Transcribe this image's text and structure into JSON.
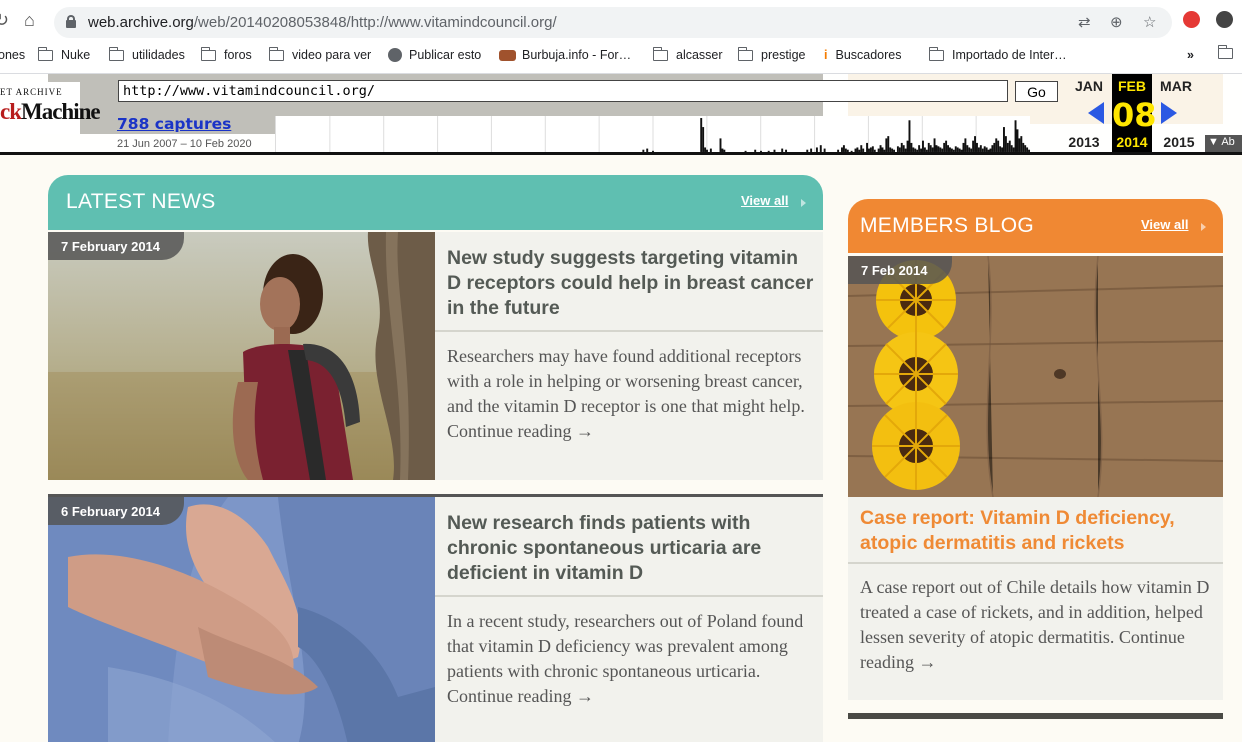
{
  "browser": {
    "url_host": "web.archive.org",
    "url_path": "/web/20140208053848/http://www.vitamindcouncil.org/"
  },
  "bookmarks": [
    {
      "label": "ones",
      "icon": "none"
    },
    {
      "label": "Nuke",
      "icon": "folder-icon"
    },
    {
      "label": "utilidades",
      "icon": "folder-icon"
    },
    {
      "label": "foros",
      "icon": "folder-icon"
    },
    {
      "label": "video para ver",
      "icon": "folder-icon"
    },
    {
      "label": "Publicar esto",
      "icon": "globe-icon"
    },
    {
      "label": "Burbuja.info - For…",
      "icon": "bread-icon"
    },
    {
      "label": "alcasser",
      "icon": "folder-icon"
    },
    {
      "label": "prestige",
      "icon": "folder-icon"
    },
    {
      "label": "Buscadores",
      "icon": "info-icon"
    },
    {
      "label": "Importado de Inter…",
      "icon": "folder-icon"
    }
  ],
  "bookmarks_overflow": "»",
  "wayback": {
    "logo_top": "ET ARCHIVE",
    "logo_red": "ck",
    "logo_black": "Machine",
    "url_value": "http://www.vitamindcouncil.org/",
    "go_label": "Go",
    "captures_label": "788 captures",
    "date_range": "21 Jun 2007 – 10 Feb 2020",
    "months": {
      "prev": "JAN",
      "current": "FEB",
      "next": "MAR"
    },
    "day": "08",
    "years": {
      "prev": "2013",
      "current": "2014",
      "next": "2015"
    },
    "about_label": "Ab",
    "sparkline": [
      0,
      0,
      0,
      0,
      0,
      0,
      0,
      0,
      0,
      0,
      0,
      0,
      0,
      0,
      0,
      0,
      0,
      0,
      0,
      0,
      0,
      0,
      0,
      0,
      0,
      0,
      0,
      0,
      0,
      0,
      0,
      0,
      0,
      0,
      0,
      0,
      0,
      0,
      0,
      0,
      0,
      0,
      0,
      0,
      0,
      0,
      0,
      0,
      0,
      0,
      0,
      0,
      0,
      0,
      0,
      0,
      0,
      0,
      0,
      0,
      0,
      0,
      0,
      0,
      0,
      0,
      0,
      0,
      0,
      0,
      0,
      0,
      0,
      0,
      0,
      0,
      0,
      0,
      0,
      0,
      0,
      0,
      0,
      0,
      0,
      0,
      0,
      0,
      0,
      0,
      0,
      0,
      0,
      0,
      0,
      0,
      0,
      0,
      0,
      0,
      0,
      0,
      0,
      0,
      0,
      0,
      0,
      0,
      0,
      0,
      0,
      0,
      0,
      0,
      0,
      0,
      0,
      0,
      0,
      0,
      0,
      0,
      0,
      0,
      0,
      0,
      0,
      0,
      0,
      0,
      0,
      0,
      0,
      0,
      0,
      0,
      0,
      0,
      0,
      0,
      0,
      0,
      0,
      0,
      0,
      0,
      0,
      0,
      0,
      0,
      0,
      0,
      0,
      0,
      0,
      0,
      0,
      0,
      0,
      0,
      0,
      0,
      0,
      0,
      0,
      0,
      0,
      0,
      0,
      0,
      0,
      0,
      0,
      0,
      0,
      0,
      0,
      0,
      0,
      0,
      0,
      0,
      0,
      0,
      0,
      0,
      0,
      0,
      0,
      0,
      2,
      0,
      3,
      0,
      0,
      1,
      0,
      0,
      0,
      0,
      0,
      0,
      0,
      0,
      0,
      0,
      0,
      0,
      0,
      0,
      0,
      0,
      0,
      0,
      0,
      0,
      0,
      0,
      0,
      0,
      30,
      22,
      4,
      2,
      0,
      3,
      0,
      0,
      0,
      0,
      12,
      3,
      2,
      0,
      0,
      0,
      0,
      0,
      0,
      0,
      0,
      0,
      0,
      1,
      0,
      0,
      0,
      0,
      2,
      0,
      0,
      1,
      0,
      0,
      0,
      1,
      0,
      0,
      2,
      0,
      0,
      0,
      3,
      0,
      2,
      0,
      0,
      0,
      0,
      0,
      0,
      0,
      0,
      0,
      0,
      2,
      0,
      3,
      0,
      0,
      4,
      0,
      6,
      0,
      3,
      0,
      0,
      0,
      0,
      0,
      0,
      2,
      0,
      4,
      6,
      3,
      2,
      0,
      1,
      0,
      3,
      4,
      2,
      6,
      3,
      0,
      8,
      3,
      4,
      5,
      2,
      0,
      3,
      6,
      4,
      2,
      12,
      14,
      4,
      3,
      2,
      0,
      5,
      4,
      8,
      6,
      3,
      10,
      28,
      8,
      4,
      3,
      2,
      6,
      3,
      10,
      4,
      2,
      8,
      6,
      4,
      12,
      6,
      5,
      4,
      3,
      8,
      10,
      6,
      4,
      3,
      2,
      5,
      4,
      3,
      2,
      8,
      12,
      6,
      4,
      3,
      10,
      14,
      8,
      4,
      6,
      3,
      5,
      4,
      2,
      3,
      6,
      8,
      12,
      10,
      5,
      4,
      22,
      14,
      8,
      10,
      6,
      4,
      28,
      20,
      12,
      14,
      8,
      6,
      4,
      2
    ],
    "highlight_index": 572
  },
  "latest_news": {
    "title": "LATEST NEWS",
    "view_all": "View all",
    "items": [
      {
        "date": "7 February 2014",
        "headline": "New study suggests targeting vitamin D receptors could help in breast cancer in the future",
        "summary": "Researchers may have found additional receptors with a role in helping or worsening breast cancer, and the vitamin D receptor is one that might help. Continue reading →"
      },
      {
        "date": "6 February 2014",
        "headline": "New research finds patients with chronic spontaneous urticaria are deficient in vitamin D",
        "summary": "In a recent study, researchers out of Poland found that vitamin D deficiency was prevalent among patients with chronic spontaneous urticaria. Continue reading →"
      }
    ]
  },
  "members_blog": {
    "title": "MEMBERS BLOG",
    "view_all": "View all",
    "item": {
      "date": "7 Feb 2014",
      "headline": "Case report: Vitamin D deficiency, atopic dermatitis and rickets",
      "summary": "A case report out of Chile details how vitamin D treated a case of rickets, and in addition, helped lessen severity of atopic dermatitis. Continue reading →"
    }
  },
  "colors": {
    "news_header": "#5fbfb1",
    "blog_header": "#f08833",
    "blog_headline": "#ef8a35",
    "captures_link": "#1a33c7",
    "wayback_yellow": "#ffe600"
  }
}
